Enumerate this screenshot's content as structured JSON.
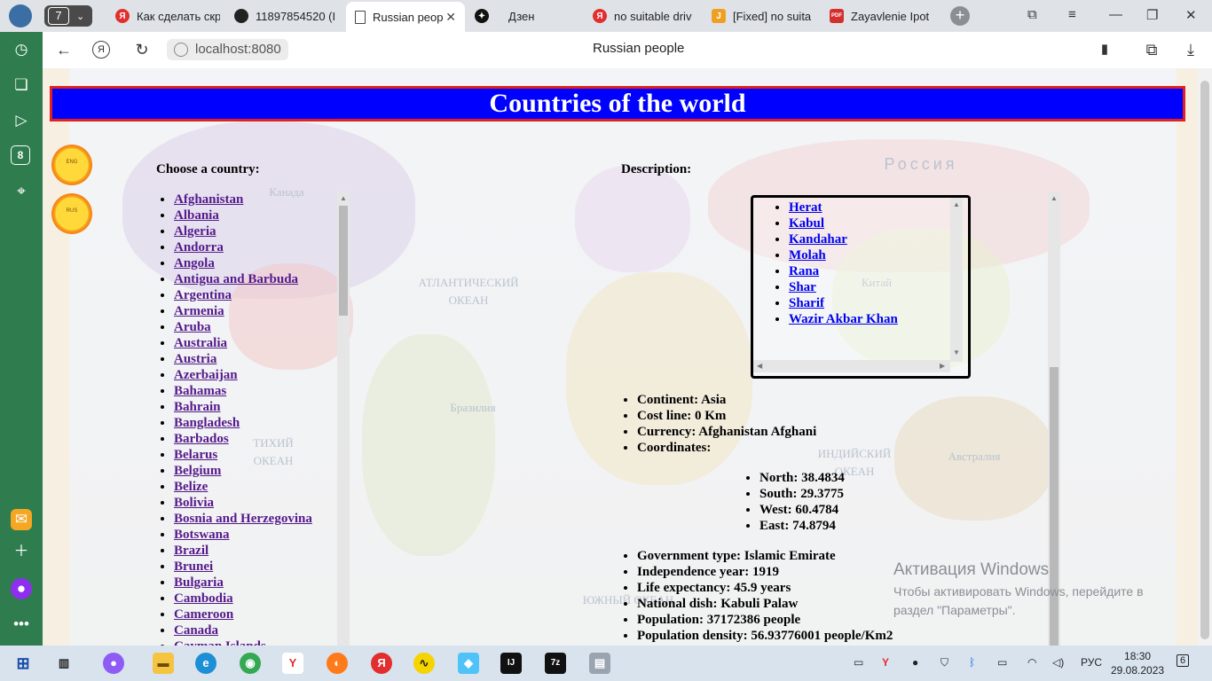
{
  "browser": {
    "tab_count": "7",
    "tabs": [
      {
        "label": "Как сделать скр",
        "favicon": "Я",
        "color": "#e22e2e"
      },
      {
        "label": "11897854520 (I",
        "favicon": "",
        "color": "#222222"
      },
      {
        "label": "Russian peop",
        "favicon": "",
        "color": "#ffffff"
      },
      {
        "label": "Дзен",
        "favicon": "",
        "color": "#111111"
      },
      {
        "label": "no suitable driv",
        "favicon": "Я",
        "color": "#e22e2e"
      },
      {
        "label": "[Fixed] no suita",
        "favicon": "J",
        "color": "#f0a020"
      },
      {
        "label": "Zayavlenie Ipot",
        "favicon": "PDF",
        "color": "#d32f2f"
      }
    ],
    "url": "localhost:8080",
    "page_title": "Russian people"
  },
  "page": {
    "header": "Countries of the world",
    "lang_buttons": [
      "ENG",
      "RUS"
    ],
    "choose_label": "Choose a country:",
    "description_label": "Description:",
    "countries": [
      "Afghanistan",
      "Albania",
      "Algeria",
      "Andorra",
      "Angola",
      "Antigua and Barbuda",
      "Argentina",
      "Armenia",
      "Aruba",
      "Australia",
      "Austria",
      "Azerbaijan",
      "Bahamas",
      "Bahrain",
      "Bangladesh",
      "Barbados",
      "Belarus",
      "Belgium",
      "Belize",
      "Bolivia",
      "Bosnia and Herzegovina",
      "Botswana",
      "Brazil",
      "Brunei",
      "Bulgaria",
      "Cambodia",
      "Cameroon",
      "Canada",
      "Cayman Islands"
    ],
    "cities": [
      "Herat",
      "Kabul",
      "Kandahar",
      "Molah",
      "Rana",
      "Shar",
      "Sharif",
      "Wazir Akbar Khan"
    ],
    "details_top": [
      "Continent: Asia",
      "Cost line: 0 Km",
      "Currency: Afghanistan Afghani",
      "Coordinates:"
    ],
    "coordinates": [
      "North: 38.4834",
      "South: 29.3775",
      "West: 60.4784",
      "East: 74.8794"
    ],
    "details_bottom": [
      "Government type: Islamic Emirate",
      "Independence year: 1919",
      "Life expectancy: 45.9 years",
      "National dish: Kabuli Palaw",
      "Population: 37172386 people",
      "Population density: 56.93776001 people/Km2"
    ],
    "map_labels": [
      "АТЛАНТИЧЕСКИЙ ОКЕАН",
      "ТИХИЙ ОКЕАН",
      "ИНДИЙСКИЙ ОКЕАН",
      "ЮЖНЫЙ ОКЕАН",
      "Россия",
      "Австралия",
      "Бразилия",
      "Китай",
      "Канада"
    ]
  },
  "watermark": {
    "title": "Активация Windows",
    "text": "Чтобы активировать Windows, перейдите в раздел \"Параметры\"."
  },
  "taskbar": {
    "lang": "РУС",
    "time": "18:30",
    "date": "29.08.2023",
    "notifications": "6"
  }
}
